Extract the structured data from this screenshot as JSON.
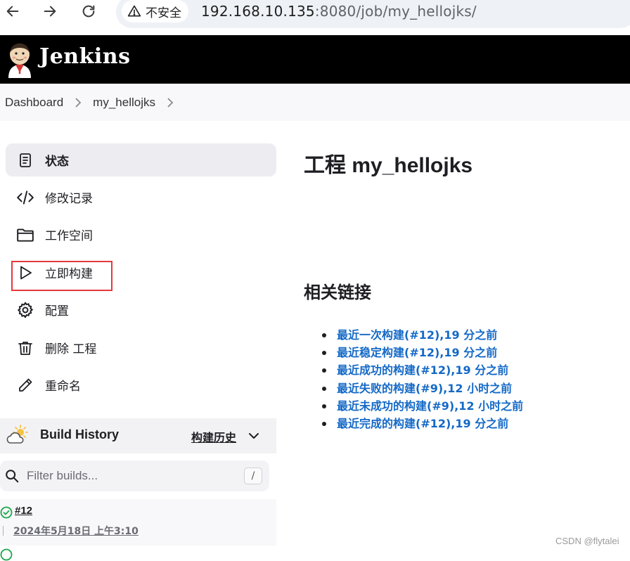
{
  "browser": {
    "security_label": "不安全",
    "url_host": "192.168.10.135",
    "url_rest": ":8080/job/my_hellojks/"
  },
  "header": {
    "brand": "Jenkins"
  },
  "breadcrumb": {
    "items": [
      "Dashboard",
      "my_hellojks"
    ]
  },
  "sidebar": {
    "items": [
      {
        "label": "状态",
        "icon": "status-icon"
      },
      {
        "label": "修改记录",
        "icon": "code-icon"
      },
      {
        "label": "工作空间",
        "icon": "folder-icon"
      },
      {
        "label": "立即构建",
        "icon": "play-icon"
      },
      {
        "label": "配置",
        "icon": "gear-icon"
      },
      {
        "label": "删除 工程",
        "icon": "trash-icon"
      },
      {
        "label": "重命名",
        "icon": "pencil-icon"
      }
    ]
  },
  "build_history": {
    "title": "Build History",
    "trend_label": "构建历史",
    "filter_placeholder": "Filter builds...",
    "shortcut_key": "/",
    "builds": [
      {
        "number": "#12",
        "time": "2024年5月18日 上午3:10",
        "status": "success"
      }
    ]
  },
  "main": {
    "title": "工程 my_hellojks",
    "related_links_title": "相关链接",
    "links": [
      "最近一次构建(#12),19 分之前",
      "最近稳定构建(#12),19 分之前",
      "最近成功的构建(#12),19 分之前",
      "最近失败的构建(#9),12 小时之前",
      "最近未成功的构建(#9),12 小时之前",
      "最近完成的构建(#12),19 分之前"
    ]
  },
  "watermark": "CSDN @flytalei",
  "colors": {
    "header_bg": "#000000",
    "link": "#1469c7",
    "highlight": "#e5383b",
    "success": "#1ea64b"
  }
}
